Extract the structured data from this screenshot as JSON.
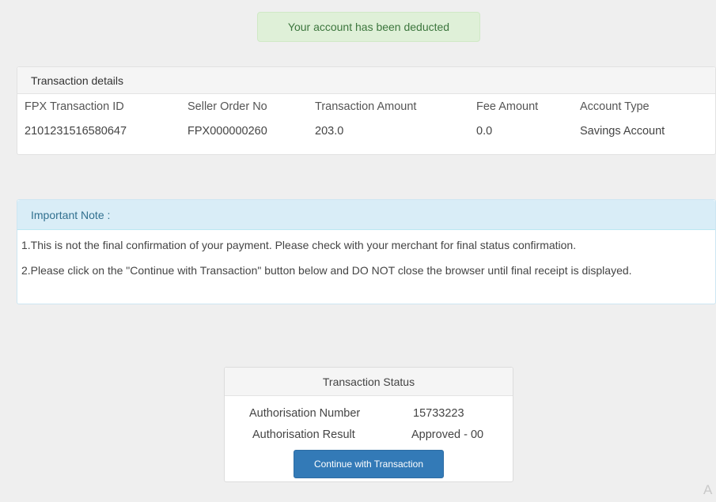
{
  "alert": {
    "text": "Your account has been deducted"
  },
  "transaction_details": {
    "heading": "Transaction details",
    "columns": [
      "FPX Transaction ID",
      "Seller Order No",
      "Transaction Amount",
      "Fee Amount",
      "Account Type"
    ],
    "rows": [
      [
        "2101231516580647",
        "FPX000000260",
        "203.0",
        "0.0",
        "Savings Account"
      ]
    ]
  },
  "note": {
    "heading": "Important Note :",
    "lines": [
      "1.This is not the final confirmation of your payment. Please check with your merchant for final status confirmation.",
      "2.Please click on the \"Continue with Transaction\" button below and DO NOT close the browser until final receipt is displayed."
    ]
  },
  "status": {
    "heading": "Transaction Status",
    "auth_number_label": "Authorisation Number",
    "auth_number_value": "15733223",
    "auth_result_label": "Authorisation Result",
    "auth_result_value": "Approved - 00",
    "continue_button": "Continue with Transaction"
  },
  "corner_glyph": "A"
}
